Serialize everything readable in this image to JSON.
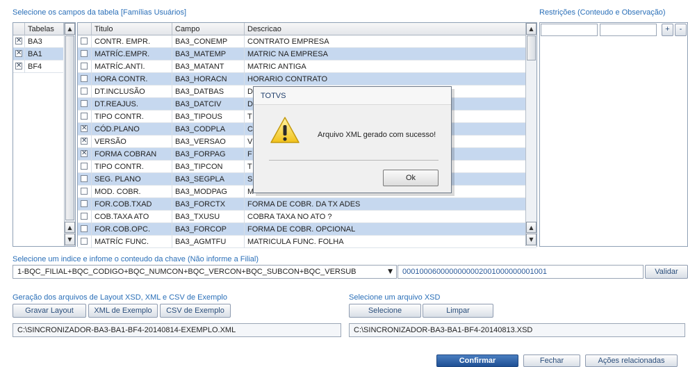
{
  "labels": {
    "fields_title": "Selecione os campos da tabela [Famílias Usuários]",
    "restrictions_title": "Restrições (Conteudo e Observação)",
    "index_title": "Selecione um indice e infome o conteudo da chave (Não informe a Filial)",
    "gen_title": "Geração dos arquivos de Layout XSD, XML e CSV de Exemplo",
    "xsd_title": "Selecione um arquivo XSD"
  },
  "tables": {
    "header": "Tabelas",
    "items": [
      {
        "name": "BA3",
        "checked": true
      },
      {
        "name": "BA1",
        "checked": true
      },
      {
        "name": "BF4",
        "checked": true
      }
    ]
  },
  "fields": {
    "columns": [
      "Titulo",
      "Campo",
      "Descricao"
    ],
    "rows": [
      {
        "checked": false,
        "titulo": "CONTR. EMPR.",
        "campo": "BA3_CONEMP",
        "descricao": "CONTRATO EMPRESA"
      },
      {
        "checked": false,
        "titulo": "MATRÍC.EMPR.",
        "campo": "BA3_MATEMP",
        "descricao": "MATRIC NA EMPRESA"
      },
      {
        "checked": false,
        "titulo": "MATRÍC.ANTI.",
        "campo": "BA3_MATANT",
        "descricao": "MATRIC ANTIGA"
      },
      {
        "checked": false,
        "titulo": "HORA CONTR.",
        "campo": "BA3_HORACN",
        "descricao": "HORARIO CONTRATO"
      },
      {
        "checked": false,
        "titulo": "DT.INCLUSÃO",
        "campo": "BA3_DATBAS",
        "descricao": "D"
      },
      {
        "checked": false,
        "titulo": "DT.REAJUS.",
        "campo": "BA3_DATCIV",
        "descricao": "D"
      },
      {
        "checked": false,
        "titulo": "TIPO CONTR.",
        "campo": "BA3_TIPOUS",
        "descricao": "T"
      },
      {
        "checked": true,
        "titulo": "CÓD.PLANO",
        "campo": "BA3_CODPLA",
        "descricao": "C"
      },
      {
        "checked": true,
        "titulo": "VERSÃO",
        "campo": "BA3_VERSAO",
        "descricao": "V"
      },
      {
        "checked": true,
        "titulo": "FORMA COBRAN",
        "campo": "BA3_FORPAG",
        "descricao": "F"
      },
      {
        "checked": false,
        "titulo": "TIPO CONTR.",
        "campo": "BA3_TIPCON",
        "descricao": "T"
      },
      {
        "checked": false,
        "titulo": "SEG. PLANO",
        "campo": "BA3_SEGPLA",
        "descricao": "S"
      },
      {
        "checked": false,
        "titulo": "MOD. COBR.",
        "campo": "BA3_MODPAG",
        "descricao": "M"
      },
      {
        "checked": false,
        "titulo": "FOR.COB.TXAD",
        "campo": "BA3_FORCTX",
        "descricao": "FORMA DE COBR. DA TX ADES"
      },
      {
        "checked": false,
        "titulo": "COB.TAXA ATO",
        "campo": "BA3_TXUSU",
        "descricao": "COBRA TAXA NO ATO ?"
      },
      {
        "checked": false,
        "titulo": "FOR.COB.OPC.",
        "campo": "BA3_FORCOP",
        "descricao": "FORMA DE COBR. OPCIONAL"
      },
      {
        "checked": false,
        "titulo": "MATRÍC FUNC.",
        "campo": "BA3_AGMTFU",
        "descricao": "MATRICULA FUNC. FOLHA"
      }
    ]
  },
  "restrictions": {
    "add_label": "+",
    "remove_label": "-"
  },
  "index": {
    "selected": "1-BQC_FILIAL+BQC_CODIGO+BQC_NUMCON+BQC_VERCON+BQC_SUBCON+BQC_VERSUB",
    "key_value": "0001000600000000002001000000001001",
    "validate_label": "Validar"
  },
  "generation": {
    "gravar_label": "Gravar Layout",
    "xml_label": "XML de Exemplo",
    "csv_label": "CSV de Exemplo",
    "xml_path": "C:\\SINCRONIZADOR-BA3-BA1-BF4-20140814-EXEMPLO.XML"
  },
  "xsd": {
    "select_label": "Selecione",
    "clear_label": "Limpar",
    "xsd_path": "C:\\SINCRONIZADOR-BA3-BA1-BF4-20140813.XSD"
  },
  "footer": {
    "confirm_label": "Confirmar",
    "close_label": "Fechar",
    "actions_label": "Ações relacionadas"
  },
  "dialog": {
    "title": "TOTVS",
    "message": "Arquivo XML gerado com sucesso!",
    "ok_label": "Ok",
    "icon": "warning-icon"
  },
  "colors": {
    "accent": "#2a6fb8",
    "row_highlight": "#c6d8ef",
    "primary_button": "#1e4f94"
  }
}
